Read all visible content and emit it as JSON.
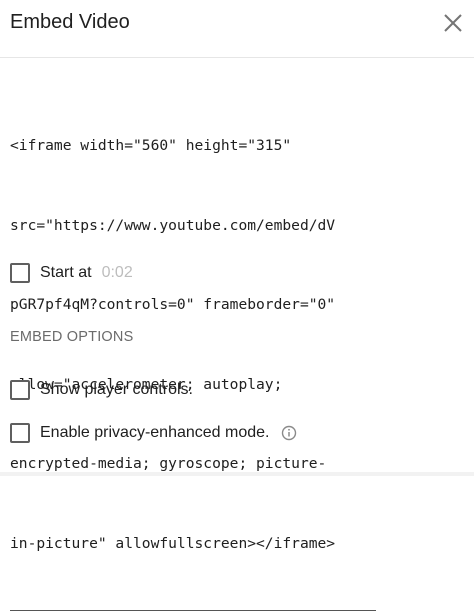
{
  "dialog": {
    "title": "Embed Video",
    "close_icon": "close-icon"
  },
  "embed_code": {
    "lines": [
      "<iframe width=\"560\" height=\"315\"",
      "src=\"https://www.youtube.com/embed/dV",
      "pGR7pf4qM?controls=0\" frameborder=\"0\"",
      "allow=\"accelerometer; autoplay;",
      "encrypted-media; gyroscope; picture-",
      "in-picture\" allowfullscreen></iframe>"
    ]
  },
  "start_at": {
    "label": "Start at",
    "time": "0:02",
    "checked": false
  },
  "embed_options": {
    "heading": "EMBED OPTIONS",
    "show_controls": {
      "label": "Show player controls.",
      "checked": false
    },
    "privacy_mode": {
      "label": "Enable privacy-enhanced mode.",
      "checked": false,
      "info_icon": "info-icon"
    }
  },
  "colors": {
    "text": "#202020",
    "muted": "#6b6b6b",
    "placeholder": "#bdbdbd",
    "checkbox_border": "#5f5f5f"
  }
}
